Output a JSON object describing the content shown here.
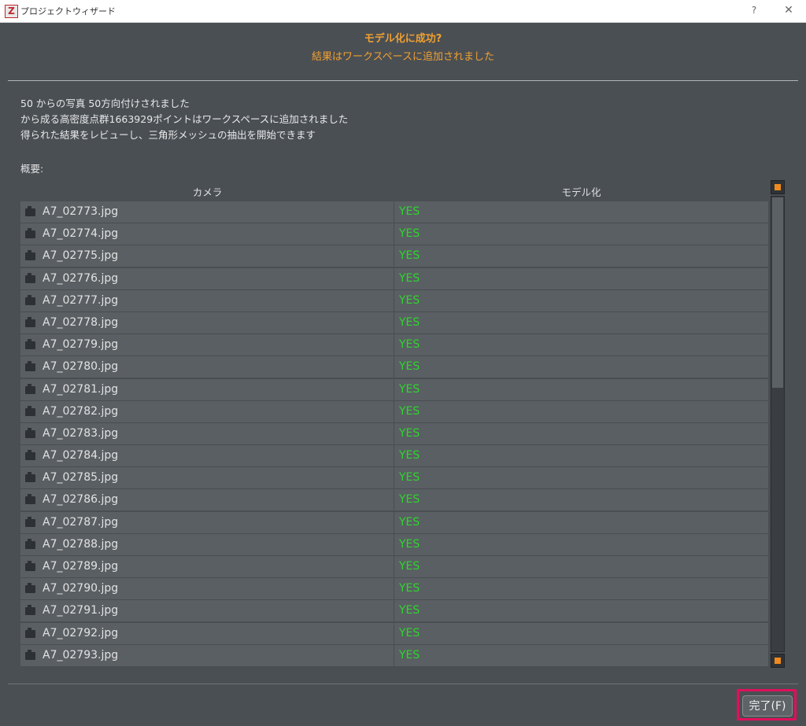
{
  "window": {
    "title": "プロジェクトウィザード",
    "app_icon_letter": "Z",
    "help": "?",
    "close": "✕"
  },
  "header": {
    "headline": "モデル化に成功?",
    "subline": "結果はワークスペースに追加されました"
  },
  "messages": [
    "50 からの写真 50方向付けされました",
    "から成る高密度点群1663929ポイントはワークスペースに追加されました",
    "得られた結果をレビューし、三角形メッシュの抽出を開始できます"
  ],
  "summary_label": "概要:",
  "table": {
    "columns": [
      "カメラ",
      "モデル化"
    ],
    "rows": [
      {
        "camera": "A7_02773.jpg",
        "modeled": "YES"
      },
      {
        "camera": "A7_02774.jpg",
        "modeled": "YES"
      },
      {
        "camera": "A7_02775.jpg",
        "modeled": "YES"
      },
      {
        "camera": "A7_02776.jpg",
        "modeled": "YES"
      },
      {
        "camera": "A7_02777.jpg",
        "modeled": "YES"
      },
      {
        "camera": "A7_02778.jpg",
        "modeled": "YES"
      },
      {
        "camera": "A7_02779.jpg",
        "modeled": "YES"
      },
      {
        "camera": "A7_02780.jpg",
        "modeled": "YES"
      },
      {
        "camera": "A7_02781.jpg",
        "modeled": "YES"
      },
      {
        "camera": "A7_02782.jpg",
        "modeled": "YES"
      },
      {
        "camera": "A7_02783.jpg",
        "modeled": "YES"
      },
      {
        "camera": "A7_02784.jpg",
        "modeled": "YES"
      },
      {
        "camera": "A7_02785.jpg",
        "modeled": "YES"
      },
      {
        "camera": "A7_02786.jpg",
        "modeled": "YES"
      },
      {
        "camera": "A7_02787.jpg",
        "modeled": "YES"
      },
      {
        "camera": "A7_02788.jpg",
        "modeled": "YES"
      },
      {
        "camera": "A7_02789.jpg",
        "modeled": "YES"
      },
      {
        "camera": "A7_02790.jpg",
        "modeled": "YES"
      },
      {
        "camera": "A7_02791.jpg",
        "modeled": "YES"
      },
      {
        "camera": "A7_02792.jpg",
        "modeled": "YES"
      },
      {
        "camera": "A7_02793.jpg",
        "modeled": "YES"
      }
    ]
  },
  "footer": {
    "finish_label": "完了(F)"
  },
  "colors": {
    "accent_orange": "#f0a030",
    "yes_green": "#2ed62e",
    "highlight_pink": "#e0105a"
  },
  "icons": {
    "row_icon": "camera-icon"
  }
}
